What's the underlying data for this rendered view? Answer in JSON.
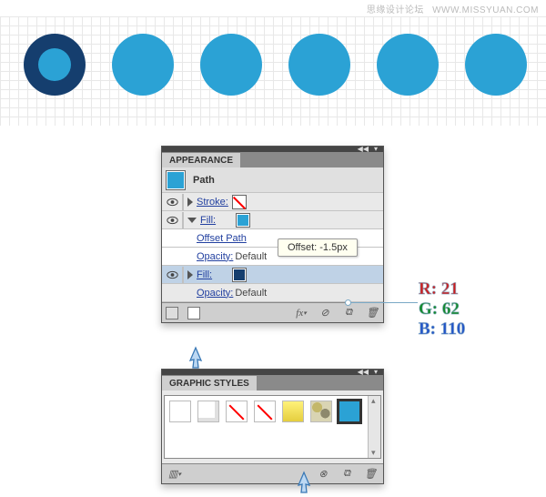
{
  "watermark": {
    "cn": "思缘设计论坛",
    "en": "WWW.MISSYUAN.COM"
  },
  "colors": {
    "dot_primary": "#2ba2d5",
    "dot_ring": "#153e6e"
  },
  "appearance": {
    "title": "APPEARANCE",
    "object": "Path",
    "stroke_label": "Stroke:",
    "fill_label": "Fill:",
    "offset_path": "Offset Path",
    "offset_tooltip": "Offset: -1.5px",
    "opacity_label": "Opacity:",
    "opacity_value": "Default",
    "fx_label": "fx"
  },
  "callout_rgb": {
    "r_label": "R:",
    "r": 21,
    "g_label": "G:",
    "g": 62,
    "b_label": "B:",
    "b": 110
  },
  "styles": {
    "title": "GRAPHIC STYLES"
  }
}
